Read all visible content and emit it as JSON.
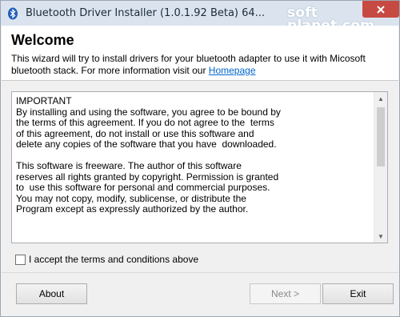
{
  "window": {
    "title": "Bluetooth Driver Installer (1.0.1.92 Beta) 64...",
    "close_label": "✕",
    "watermark_line1": "soft",
    "watermark_line2": "planet.com"
  },
  "header": {
    "heading": "Welcome",
    "intro_text": "This wizard will try to install drivers for your bluetooth adapter to use it with Micosoft bluetooth stack.  For more information visit our ",
    "homepage_link": "Homepage"
  },
  "license": {
    "text": "IMPORTANT\nBy installing and using the software, you agree to be bound by\nthe terms of this agreement. If you do not agree to the  terms\nof this agreement, do not install or use this software and\ndelete any copies of the software that you have  downloaded.\n\nThis software is freeware. The author of this software\nreserves all rights granted by copyright. Permission is granted\nto  use this software for personal and commercial purposes.\nYou may not copy, modify, sublicense, or distribute the\nProgram except as expressly authorized by the author."
  },
  "accept": {
    "label": "I accept the terms and conditions above",
    "checked": false
  },
  "buttons": {
    "about": "About",
    "next": "Next >",
    "exit": "Exit"
  },
  "colors": {
    "titlebar": "#dbe4ee",
    "close": "#c74a42",
    "link": "#0066cc"
  },
  "icons": {
    "app": "bluetooth-icon",
    "close": "close-icon"
  }
}
